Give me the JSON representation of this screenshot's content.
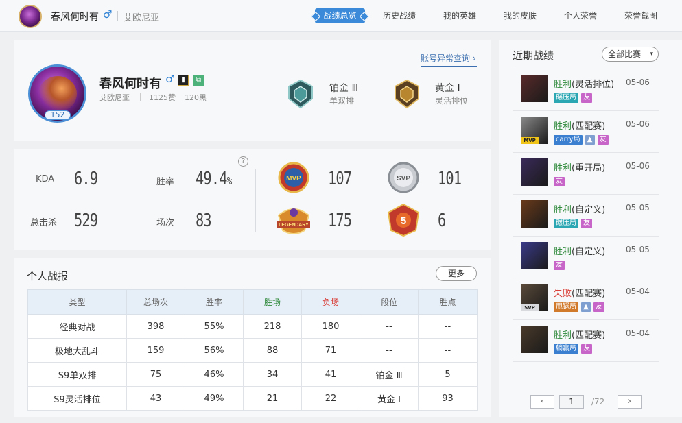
{
  "topbar": {
    "player_name": "春风何时有",
    "gender_symbol": "♂",
    "server": "艾欧尼亚",
    "nav": [
      {
        "label": "战绩总览",
        "active": true
      },
      {
        "label": "历史战绩",
        "active": false
      },
      {
        "label": "我的英雄",
        "active": false
      },
      {
        "label": "我的皮肤",
        "active": false
      },
      {
        "label": "个人荣誉",
        "active": false
      },
      {
        "label": "荣誉截图",
        "active": false
      }
    ]
  },
  "profile": {
    "name": "春风何时有",
    "gender_symbol": "♂",
    "server": "艾欧尼亚",
    "likes": "1125赞",
    "dislikes": "120黑",
    "level": "152",
    "account_check_link": "账号异常查询 ›",
    "ranks": [
      {
        "title": "铂金 Ⅲ",
        "subtitle": "单双排",
        "icon": "platinum-emblem",
        "color": "#4c9a9a"
      },
      {
        "title": "黄金 Ⅰ",
        "subtitle": "灵活排位",
        "icon": "gold-emblem",
        "color": "#b8862e"
      }
    ]
  },
  "stats": {
    "kda_label": "KDA",
    "kda_value": "6.9",
    "winrate_label": "胜率",
    "winrate_value": "49.4",
    "winrate_unit": "%",
    "kills_label": "总击杀",
    "kills_value": "529",
    "games_label": "场次",
    "games_value": "83",
    "help_icon": "?",
    "medals": [
      {
        "name": "mvp-medal",
        "text": "MVP",
        "count": "107"
      },
      {
        "name": "svp-medal",
        "text": "SVP",
        "count": "101"
      },
      {
        "name": "legendary-medal",
        "text": "LEGENDARY",
        "count": "175"
      },
      {
        "name": "pentakill-medal",
        "text": "5",
        "count": "6"
      }
    ]
  },
  "report": {
    "title": "个人战报",
    "more_label": "更多",
    "headers": [
      "类型",
      "总场次",
      "胜率",
      "胜场",
      "负场",
      "段位",
      "胜点"
    ],
    "rows": [
      [
        "经典对战",
        "398",
        "55%",
        "218",
        "180",
        "--",
        "--"
      ],
      [
        "极地大乱斗",
        "159",
        "56%",
        "88",
        "71",
        "--",
        "--"
      ],
      [
        "S9单双排",
        "75",
        "46%",
        "34",
        "41",
        "铂金 Ⅲ",
        "5"
      ],
      [
        "S9灵活排位",
        "43",
        "49%",
        "21",
        "22",
        "黄金 Ⅰ",
        "93"
      ]
    ]
  },
  "recent": {
    "title": "近期战绩",
    "filter_label": "全部比赛",
    "matches": [
      {
        "result": "胜利",
        "mode": "(灵活排位)",
        "date": "05-06",
        "win": true,
        "tags": [
          {
            "text": "碾压局",
            "color": "cyan"
          },
          {
            "text": "友",
            "color": "pink"
          }
        ],
        "badge": "",
        "hero_color": "#5a2a2a"
      },
      {
        "result": "胜利",
        "mode": "(匹配赛)",
        "date": "05-06",
        "win": true,
        "tags": [
          {
            "text": "carry局",
            "color": "blue"
          },
          {
            "text": "▲",
            "color": "img"
          },
          {
            "text": "友",
            "color": "pink"
          }
        ],
        "badge": "MVP",
        "hero_color": "#8a8a8a"
      },
      {
        "result": "胜利",
        "mode": "(重开局)",
        "date": "05-06",
        "win": true,
        "tags": [
          {
            "text": "友",
            "color": "pink"
          }
        ],
        "badge": "",
        "hero_color": "#3a2a5a"
      },
      {
        "result": "胜利",
        "mode": "(自定义)",
        "date": "05-05",
        "win": true,
        "tags": [
          {
            "text": "碾压局",
            "color": "cyan"
          },
          {
            "text": "友",
            "color": "pink"
          }
        ],
        "badge": "",
        "hero_color": "#6a3a1a"
      },
      {
        "result": "胜利",
        "mode": "(自定义)",
        "date": "05-05",
        "win": true,
        "tags": [
          {
            "text": "友",
            "color": "pink"
          }
        ],
        "badge": "",
        "hero_color": "#3a3a8a"
      },
      {
        "result": "失败",
        "mode": "(匹配赛)",
        "date": "05-04",
        "win": false,
        "tags": [
          {
            "text": "甩锅局",
            "color": "orange"
          },
          {
            "text": "▲",
            "color": "img"
          },
          {
            "text": "友",
            "color": "pink"
          }
        ],
        "badge": "SVP",
        "hero_color": "#5a4a3a"
      },
      {
        "result": "胜利",
        "mode": "(匹配赛)",
        "date": "05-04",
        "win": true,
        "tags": [
          {
            "text": "躺赢局",
            "color": "blue"
          },
          {
            "text": "友",
            "color": "pink"
          }
        ],
        "badge": "",
        "hero_color": "#4a3a2a"
      }
    ],
    "pager": {
      "prev": "‹",
      "current": "1",
      "total": "/72",
      "next": "›"
    }
  }
}
